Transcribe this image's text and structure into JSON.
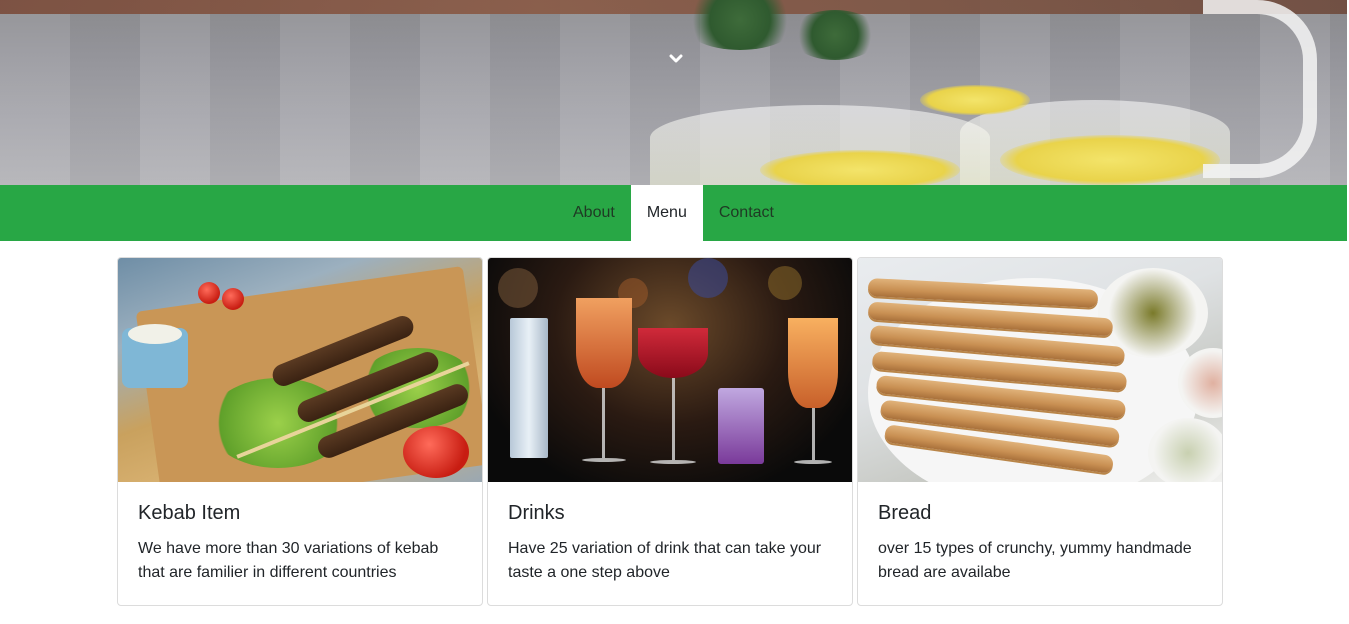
{
  "hero": {
    "scroll_icon": "chevron-down-icon"
  },
  "nav": {
    "items": [
      {
        "label": "About",
        "active": false
      },
      {
        "label": "Menu",
        "active": true
      },
      {
        "label": "Contact",
        "active": false
      }
    ],
    "background": "#28a745",
    "active_background": "#ffffff"
  },
  "cards": [
    {
      "title": "Kebab Item",
      "text": "We have more than 30 variations of kebab that are familier in different countries",
      "image": "kebab-photo"
    },
    {
      "title": "Drinks",
      "text": "Have 25 variation of drink that can take your taste a one step above",
      "image": "drinks-photo"
    },
    {
      "title": "Bread",
      "text": "over 15 types of crunchy, yummy handmade bread are availabe",
      "image": "bread-photo"
    }
  ]
}
